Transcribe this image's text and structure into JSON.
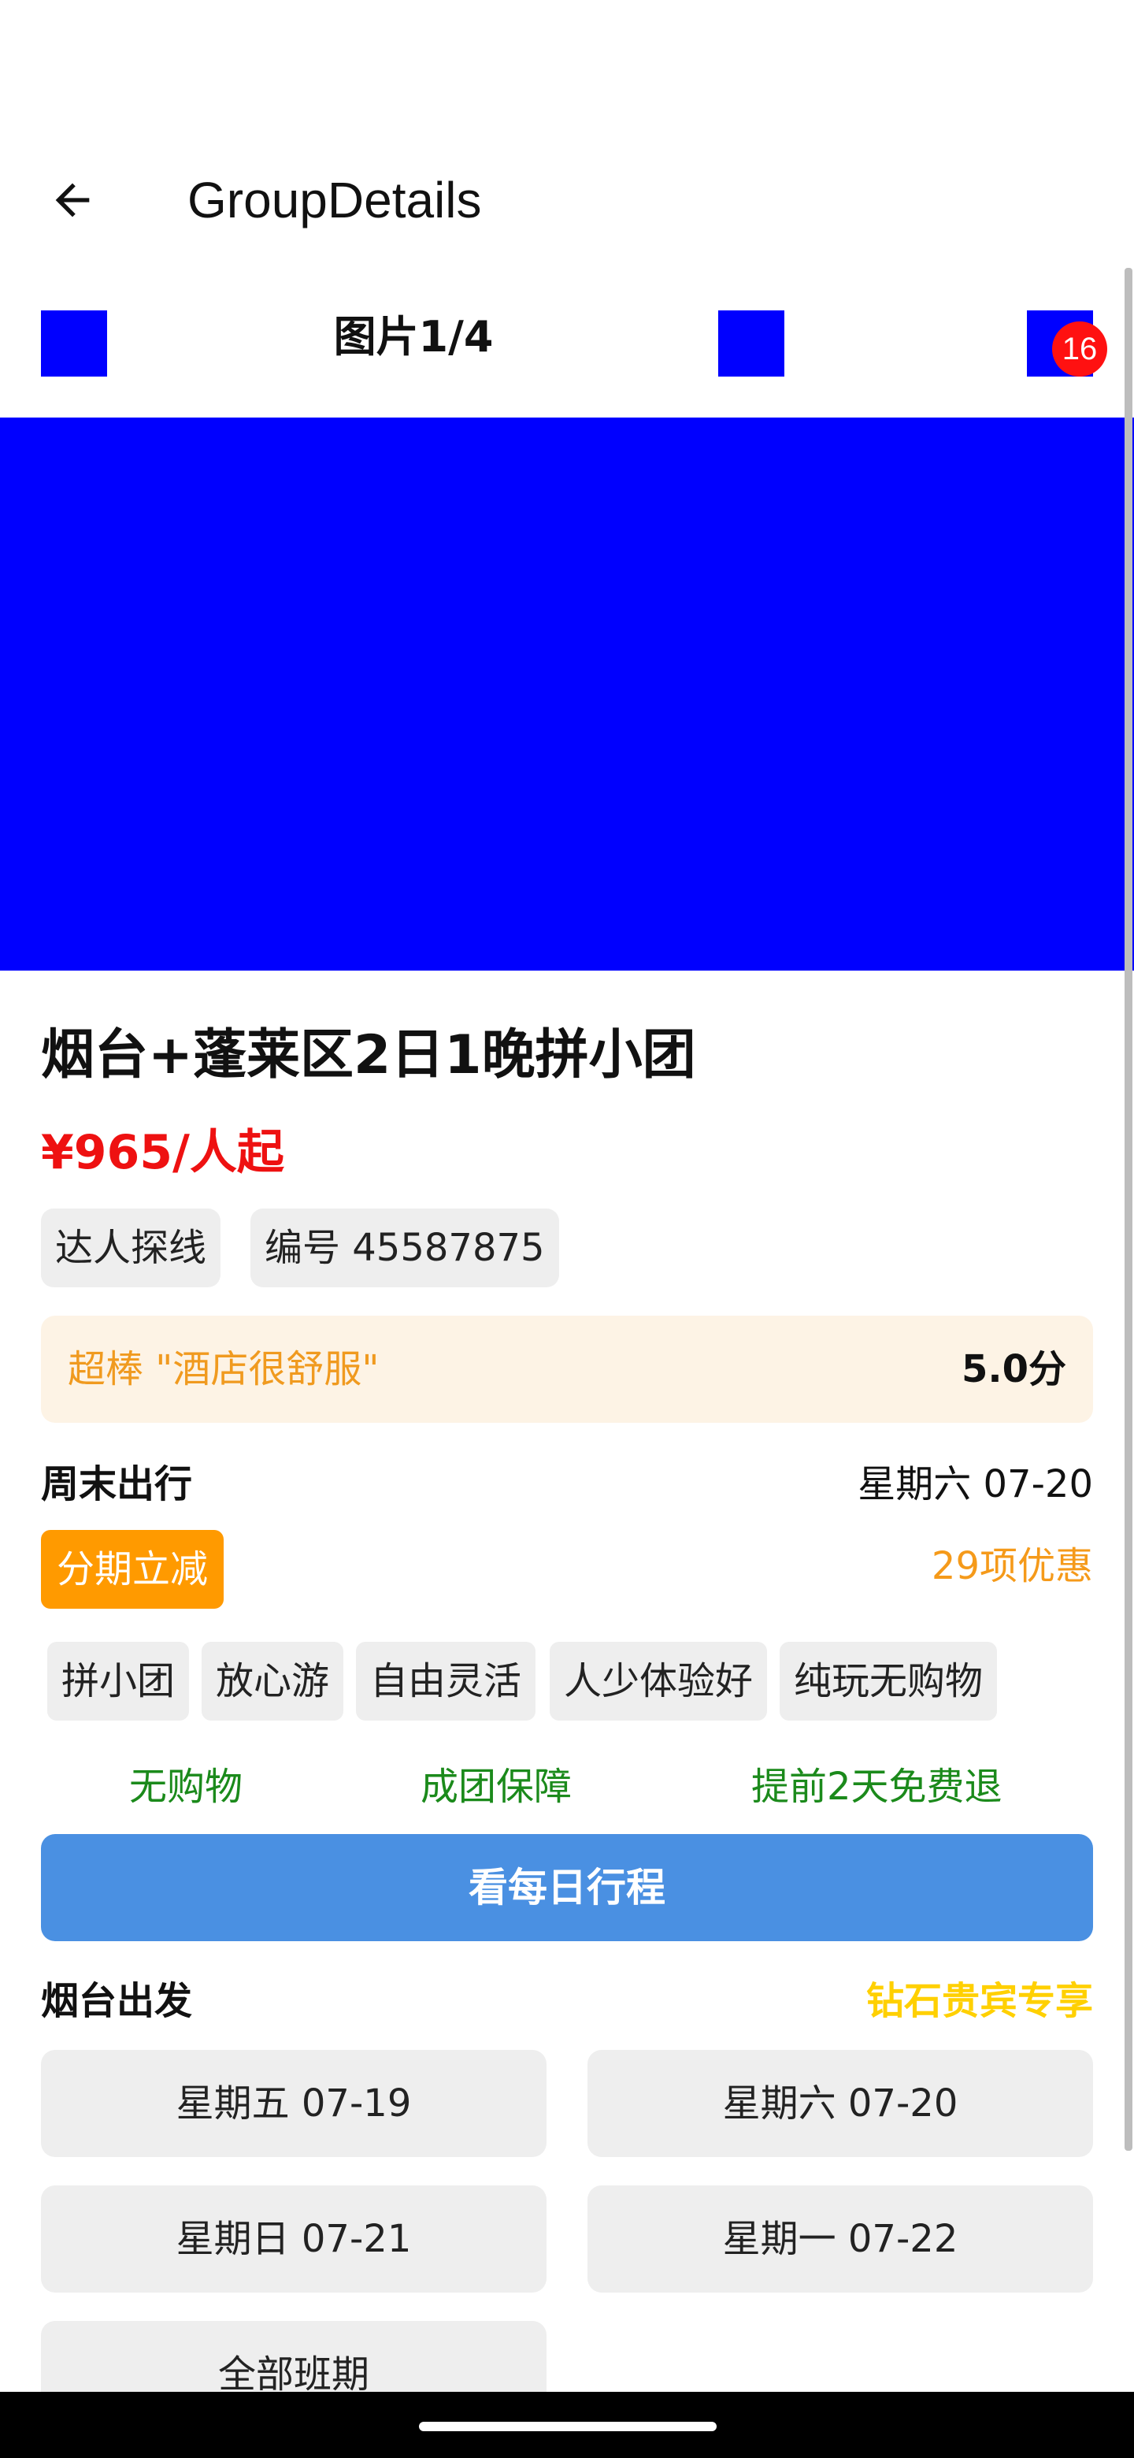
{
  "app_bar": {
    "title": "GroupDetails",
    "back_icon": "arrow-left-icon"
  },
  "gallery": {
    "label": "图片1/4",
    "badge_count": "16",
    "image_color": "#0000ff"
  },
  "product": {
    "title": "烟台+蓬莱区2日1晚拼小团",
    "price": "¥965/人起",
    "chips": [
      "达人探线",
      "编号 45587875"
    ]
  },
  "rating": {
    "text": "超棒 \"酒店很舒服\"",
    "score": "5.0分"
  },
  "weekend": {
    "label": "周末出行",
    "date": "星期六 07-20"
  },
  "promo": {
    "tag": "分期立减",
    "count": "29项优惠"
  },
  "tags": [
    "拼小团",
    "放心游",
    "自由灵活",
    "人少体验好",
    "纯玩无购物"
  ],
  "guarantees": [
    "无购物",
    "成团保障",
    "提前2天免费退"
  ],
  "itinerary_button": "看每日行程",
  "departure": {
    "city": "烟台出发",
    "vip": "钻石贵宾专享",
    "dates": [
      "星期五 07-19",
      "星期六 07-20",
      "星期日 07-21",
      "星期一 07-22"
    ],
    "all": "全部班期"
  },
  "colors": {
    "price": "#ee1111",
    "promo": "#ff9a00",
    "guarantee": "#1b8a1b",
    "button": "#4a90e2",
    "vip": "#ffd000"
  }
}
